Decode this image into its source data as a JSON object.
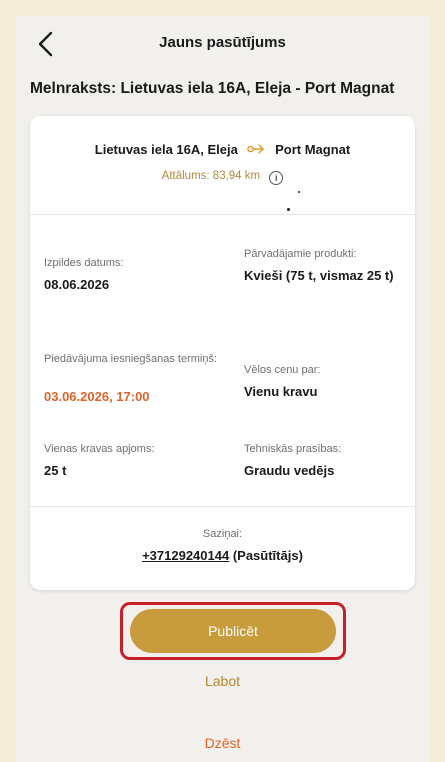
{
  "header": {
    "title": "Jauns pasūtījums",
    "draft_title": "Melnraksts: Lietuvas iela 16A, Eleja - Port Magnat"
  },
  "route": {
    "from": "Lietuvas iela 16A, Eleja",
    "to": "Port Magnat",
    "distance": "Attālums: 83,94 km"
  },
  "fields": {
    "execution_date": {
      "label": "Izpildes datums:",
      "value": "08.06.2026"
    },
    "products": {
      "label": "Pārvadājamie produkti:",
      "value": "Kvieši (75 t, vismaz 25 t)"
    },
    "offer_deadline": {
      "label": "Piedāvājuma iesniegšanas termiņš:",
      "value": "03.06.2026, 17:00"
    },
    "price_for": {
      "label": "Vēlos cenu par:",
      "value": "Vienu kravu"
    },
    "load_volume": {
      "label": "Vienas kravas apjoms:",
      "value": "25 t"
    },
    "tech_requirements": {
      "label": "Tehniskās prasības:",
      "value": "Graudu vedējs"
    }
  },
  "contacts": {
    "label": "Saziņai:",
    "phone": "+37129240144",
    "role": "(Pasūtītājs)"
  },
  "actions": {
    "publish": "Publicēt",
    "edit": "Labot",
    "delete": "Dzēst"
  },
  "colors": {
    "accent_gold": "#c89b3c",
    "accent_orange": "#e0632a",
    "highlight_red": "#c4202b",
    "background": "#f2f0ed"
  }
}
